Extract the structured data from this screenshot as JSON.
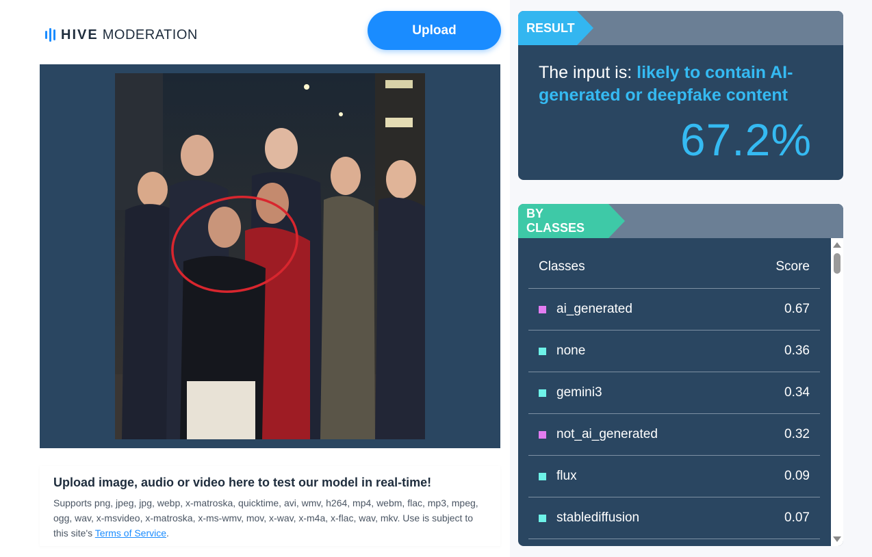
{
  "header": {
    "brand_bold": "HIVE",
    "brand_rest": "MODERATION",
    "upload_label": "Upload"
  },
  "info": {
    "title": "Upload image, audio or video here to test our model in real-time!",
    "supports": "Supports png, jpeg, jpg, webp, x-matroska, quicktime, avi, wmv, h264, mp4, webm, flac, mp3, mpeg, ogg, wav, x-msvideo, x-matroska, x-ms-wmv, mov, x-wav, x-m4a, x-flac, wav, mkv. Use is subject to this site's ",
    "tos_link": "Terms of Service",
    "tos_end": "."
  },
  "result": {
    "tag": "RESULT",
    "prefix": "The input is: ",
    "verdict": "likely to contain AI-generated or deepfake content",
    "percent": "67.2%"
  },
  "classes": {
    "tag": "BY CLASSES",
    "col_class": "Classes",
    "col_score": "Score",
    "rows": [
      {
        "name": "ai_generated",
        "score": "0.67",
        "color": "#e27cf0"
      },
      {
        "name": "none",
        "score": "0.36",
        "color": "#6ef2e8"
      },
      {
        "name": "gemini3",
        "score": "0.34",
        "color": "#6ef2e8"
      },
      {
        "name": "not_ai_generated",
        "score": "0.32",
        "color": "#e27cf0"
      },
      {
        "name": "flux",
        "score": "0.09",
        "color": "#6ef2e8"
      },
      {
        "name": "stablediffusion",
        "score": "0.07",
        "color": "#6ef2e8"
      }
    ]
  },
  "colors": {
    "accent_blue": "#1a8cff",
    "result_blue": "#35baf2",
    "classes_green": "#3ec9a7",
    "panel_navy": "#2a4661"
  }
}
